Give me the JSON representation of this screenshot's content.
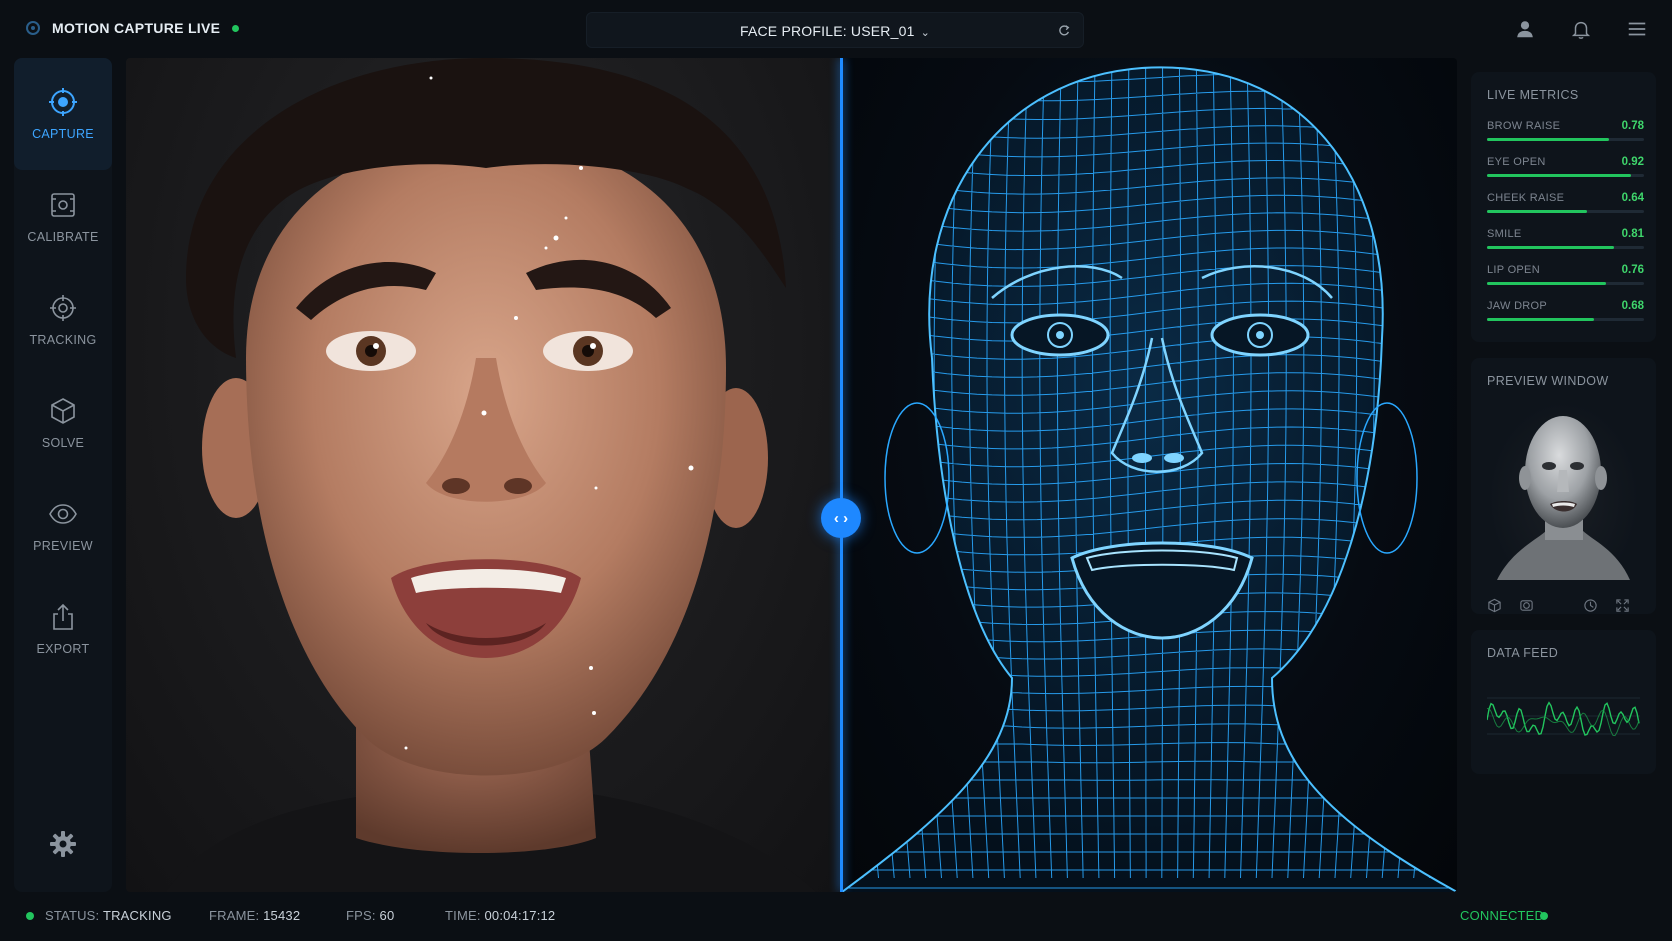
{
  "app": {
    "title": "MOTION CAPTURE LIVE"
  },
  "header": {
    "profile_label": "FACE PROFILE: USER_01",
    "icons": [
      "user-icon",
      "bell-icon",
      "menu-icon"
    ]
  },
  "sidebar": {
    "items": [
      {
        "label": "CAPTURE",
        "icon": "capture-target-icon",
        "active": true
      },
      {
        "label": "CALIBRATE",
        "icon": "calibrate-frame-icon",
        "active": false
      },
      {
        "label": "TRACKING",
        "icon": "crosshair-icon",
        "active": false
      },
      {
        "label": "SOLVE",
        "icon": "cube-icon",
        "active": false
      },
      {
        "label": "PREVIEW",
        "icon": "eye-icon",
        "active": false
      },
      {
        "label": "EXPORT",
        "icon": "export-icon",
        "active": false
      }
    ],
    "settings_icon": "gear-icon"
  },
  "metrics": {
    "title": "LIVE METRICS",
    "items": [
      {
        "name": "BROW RAISE",
        "value": "0.78",
        "level": 0.78
      },
      {
        "name": "EYE OPEN",
        "value": "0.92",
        "level": 0.92
      },
      {
        "name": "CHEEK RAISE",
        "value": "0.64",
        "level": 0.64
      },
      {
        "name": "SMILE",
        "value": "0.81",
        "level": 0.81
      },
      {
        "name": "LIP OPEN",
        "value": "0.76",
        "level": 0.76
      },
      {
        "name": "JAW DROP",
        "value": "0.68",
        "level": 0.68
      }
    ]
  },
  "preview": {
    "title": "PREVIEW WINDOW",
    "tools": [
      "cube-icon",
      "camera-icon",
      "camera-reset-icon",
      "fullscreen-icon"
    ]
  },
  "feed": {
    "title": "DATA FEED"
  },
  "status": {
    "status_label": "STATUS:",
    "status_value": "TRACKING",
    "frame_label": "FRAME:",
    "frame_value": "15432",
    "fps_label": "FPS:",
    "fps_value": "60",
    "time_label": "TIME:",
    "time_value": "00:04:17:12",
    "connection": "CONNECTED"
  },
  "colors": {
    "accent": "#1e88ff",
    "green": "#22c55e",
    "mesh": "#2aa8ff",
    "background": "#0b0f14"
  }
}
